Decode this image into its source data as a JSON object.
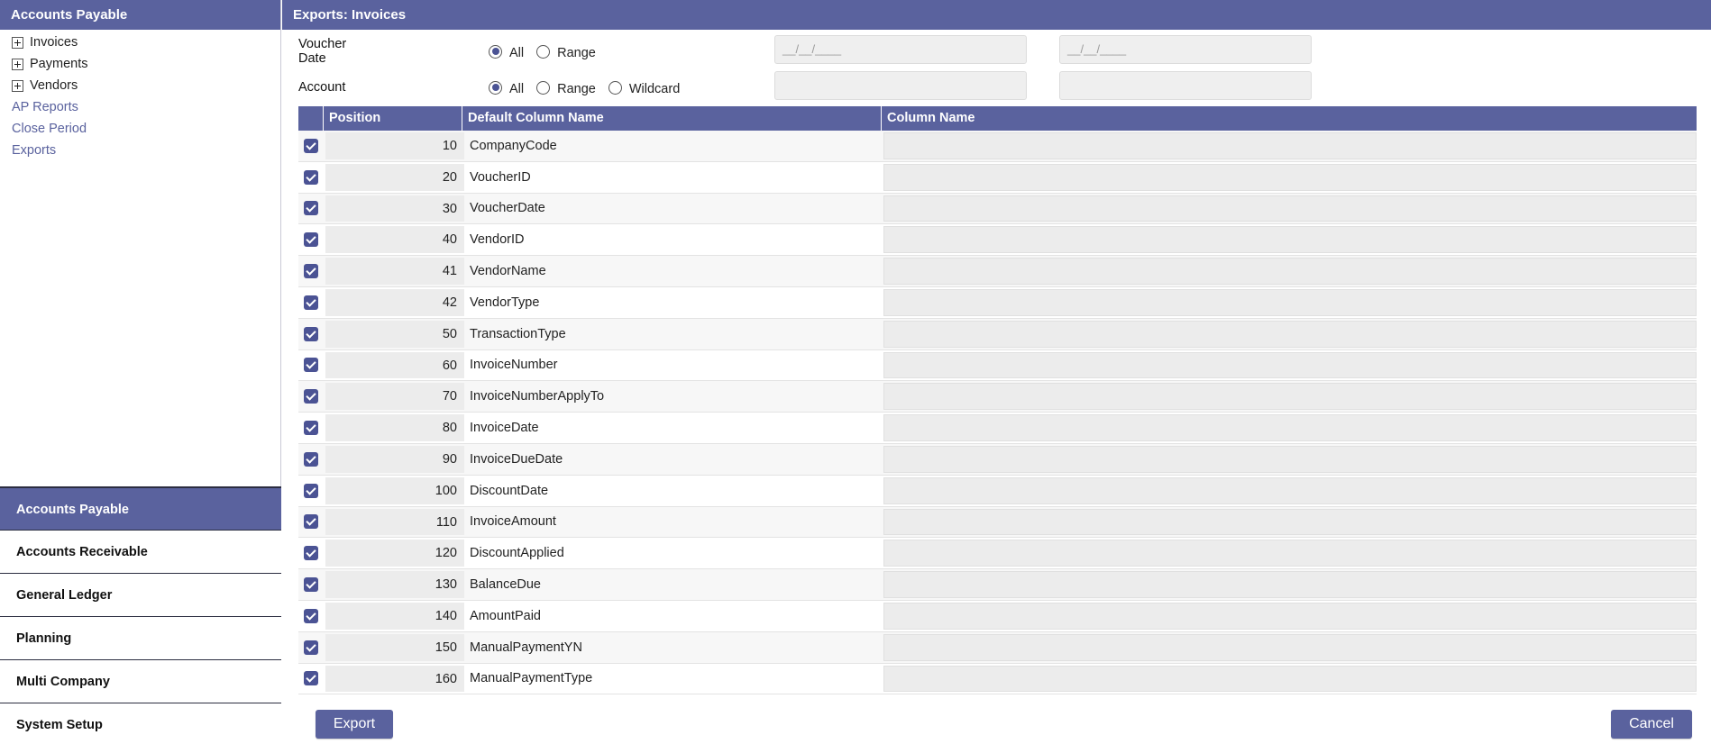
{
  "left": {
    "header": "Accounts Payable",
    "tree": [
      {
        "label": "Invoices"
      },
      {
        "label": "Payments"
      },
      {
        "label": "Vendors"
      }
    ],
    "links": [
      {
        "label": "AP Reports"
      },
      {
        "label": "Close Period"
      },
      {
        "label": "Exports"
      }
    ],
    "modules": [
      {
        "label": "Accounts Payable",
        "active": true
      },
      {
        "label": "Accounts Receivable"
      },
      {
        "label": "General Ledger"
      },
      {
        "label": "Planning"
      },
      {
        "label": "Multi Company"
      },
      {
        "label": "System Setup"
      }
    ]
  },
  "main": {
    "header": "Exports: Invoices",
    "voucher_date": {
      "label": "Voucher Date",
      "options": [
        "All",
        "Range"
      ],
      "selected": "All",
      "from_placeholder": "__/__/____",
      "to_placeholder": "__/__/____"
    },
    "account": {
      "label": "Account",
      "options": [
        "All",
        "Range",
        "Wildcard"
      ],
      "selected": "All",
      "from_value": "",
      "to_value": ""
    },
    "table": {
      "headers": {
        "position": "Position",
        "default": "Default Column Name",
        "column": "Column Name"
      },
      "rows": [
        {
          "position": "10",
          "name": "CompanyCode"
        },
        {
          "position": "20",
          "name": "VoucherID"
        },
        {
          "position": "30",
          "name": "VoucherDate"
        },
        {
          "position": "40",
          "name": "VendorID"
        },
        {
          "position": "41",
          "name": "VendorName"
        },
        {
          "position": "42",
          "name": "VendorType"
        },
        {
          "position": "50",
          "name": "TransactionType"
        },
        {
          "position": "60",
          "name": "InvoiceNumber"
        },
        {
          "position": "70",
          "name": "InvoiceNumberApplyTo"
        },
        {
          "position": "80",
          "name": "InvoiceDate"
        },
        {
          "position": "90",
          "name": "InvoiceDueDate"
        },
        {
          "position": "100",
          "name": "DiscountDate"
        },
        {
          "position": "110",
          "name": "InvoiceAmount"
        },
        {
          "position": "120",
          "name": "DiscountApplied"
        },
        {
          "position": "130",
          "name": "BalanceDue"
        },
        {
          "position": "140",
          "name": "AmountPaid"
        },
        {
          "position": "150",
          "name": "ManualPaymentYN"
        },
        {
          "position": "160",
          "name": "ManualPaymentType"
        }
      ]
    },
    "buttons": {
      "export": "Export",
      "cancel": "Cancel"
    }
  },
  "colors": {
    "accent": "#5a629e",
    "checkbox": "#4b5394"
  }
}
